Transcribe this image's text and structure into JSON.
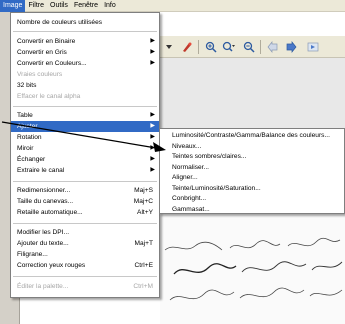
{
  "menubar": {
    "items": [
      {
        "label": "Image"
      },
      {
        "label": "Filtre"
      },
      {
        "label": "Outils"
      },
      {
        "label": "Fenêtre"
      },
      {
        "label": "Info"
      }
    ]
  },
  "menu": {
    "items": [
      {
        "label": "Nombre de couleurs utilisées"
      },
      {
        "label": "Convertir en Binaire"
      },
      {
        "label": "Convertir en Gris"
      },
      {
        "label": "Convertir en Couleurs..."
      },
      {
        "label": "Vraies couleurs"
      },
      {
        "label": "32 bits"
      },
      {
        "label": "Effacer le canal alpha"
      },
      {
        "label": "Table"
      },
      {
        "label": "Ajuster"
      },
      {
        "label": "Rotation"
      },
      {
        "label": "Miroir"
      },
      {
        "label": "Échanger"
      },
      {
        "label": "Extraire le canal"
      },
      {
        "label": "Redimensionner...",
        "shortcut": "Maj+S"
      },
      {
        "label": "Taille du canevas...",
        "shortcut": "Maj+C"
      },
      {
        "label": "Retaille automatique...",
        "shortcut": "Alt+Y"
      },
      {
        "label": "Modifier les DPI..."
      },
      {
        "label": "Ajouter du texte...",
        "shortcut": "Maj+T"
      },
      {
        "label": "Filigrane..."
      },
      {
        "label": "Correction yeux rouges",
        "shortcut": "Ctrl+E"
      },
      {
        "label": "Éditer la palette...",
        "shortcut": "Ctrl+M"
      }
    ]
  },
  "submenu": {
    "items": [
      {
        "label": "Luminosité/Contraste/Gamma/Balance des couleurs..."
      },
      {
        "label": "Niveaux..."
      },
      {
        "label": "Teintes sombres/claires..."
      },
      {
        "label": "Normaliser..."
      },
      {
        "label": "Aligner..."
      },
      {
        "label": "Teinte/Luminosité/Saturation..."
      },
      {
        "label": "Conbright..."
      },
      {
        "label": "Gammasat..."
      }
    ]
  },
  "colors": {
    "highlight": "#316ac5",
    "menu_bg": "#ffffff",
    "disabled_text": "#a6a6a6",
    "toolbar_bg": "#ece9d8"
  },
  "icons": [
    "dropdown-icon",
    "red-eye-icon",
    "zoom-in-icon",
    "zoom-out-icon",
    "back-arrow-icon",
    "forward-arrow-icon",
    "next-icon"
  ]
}
